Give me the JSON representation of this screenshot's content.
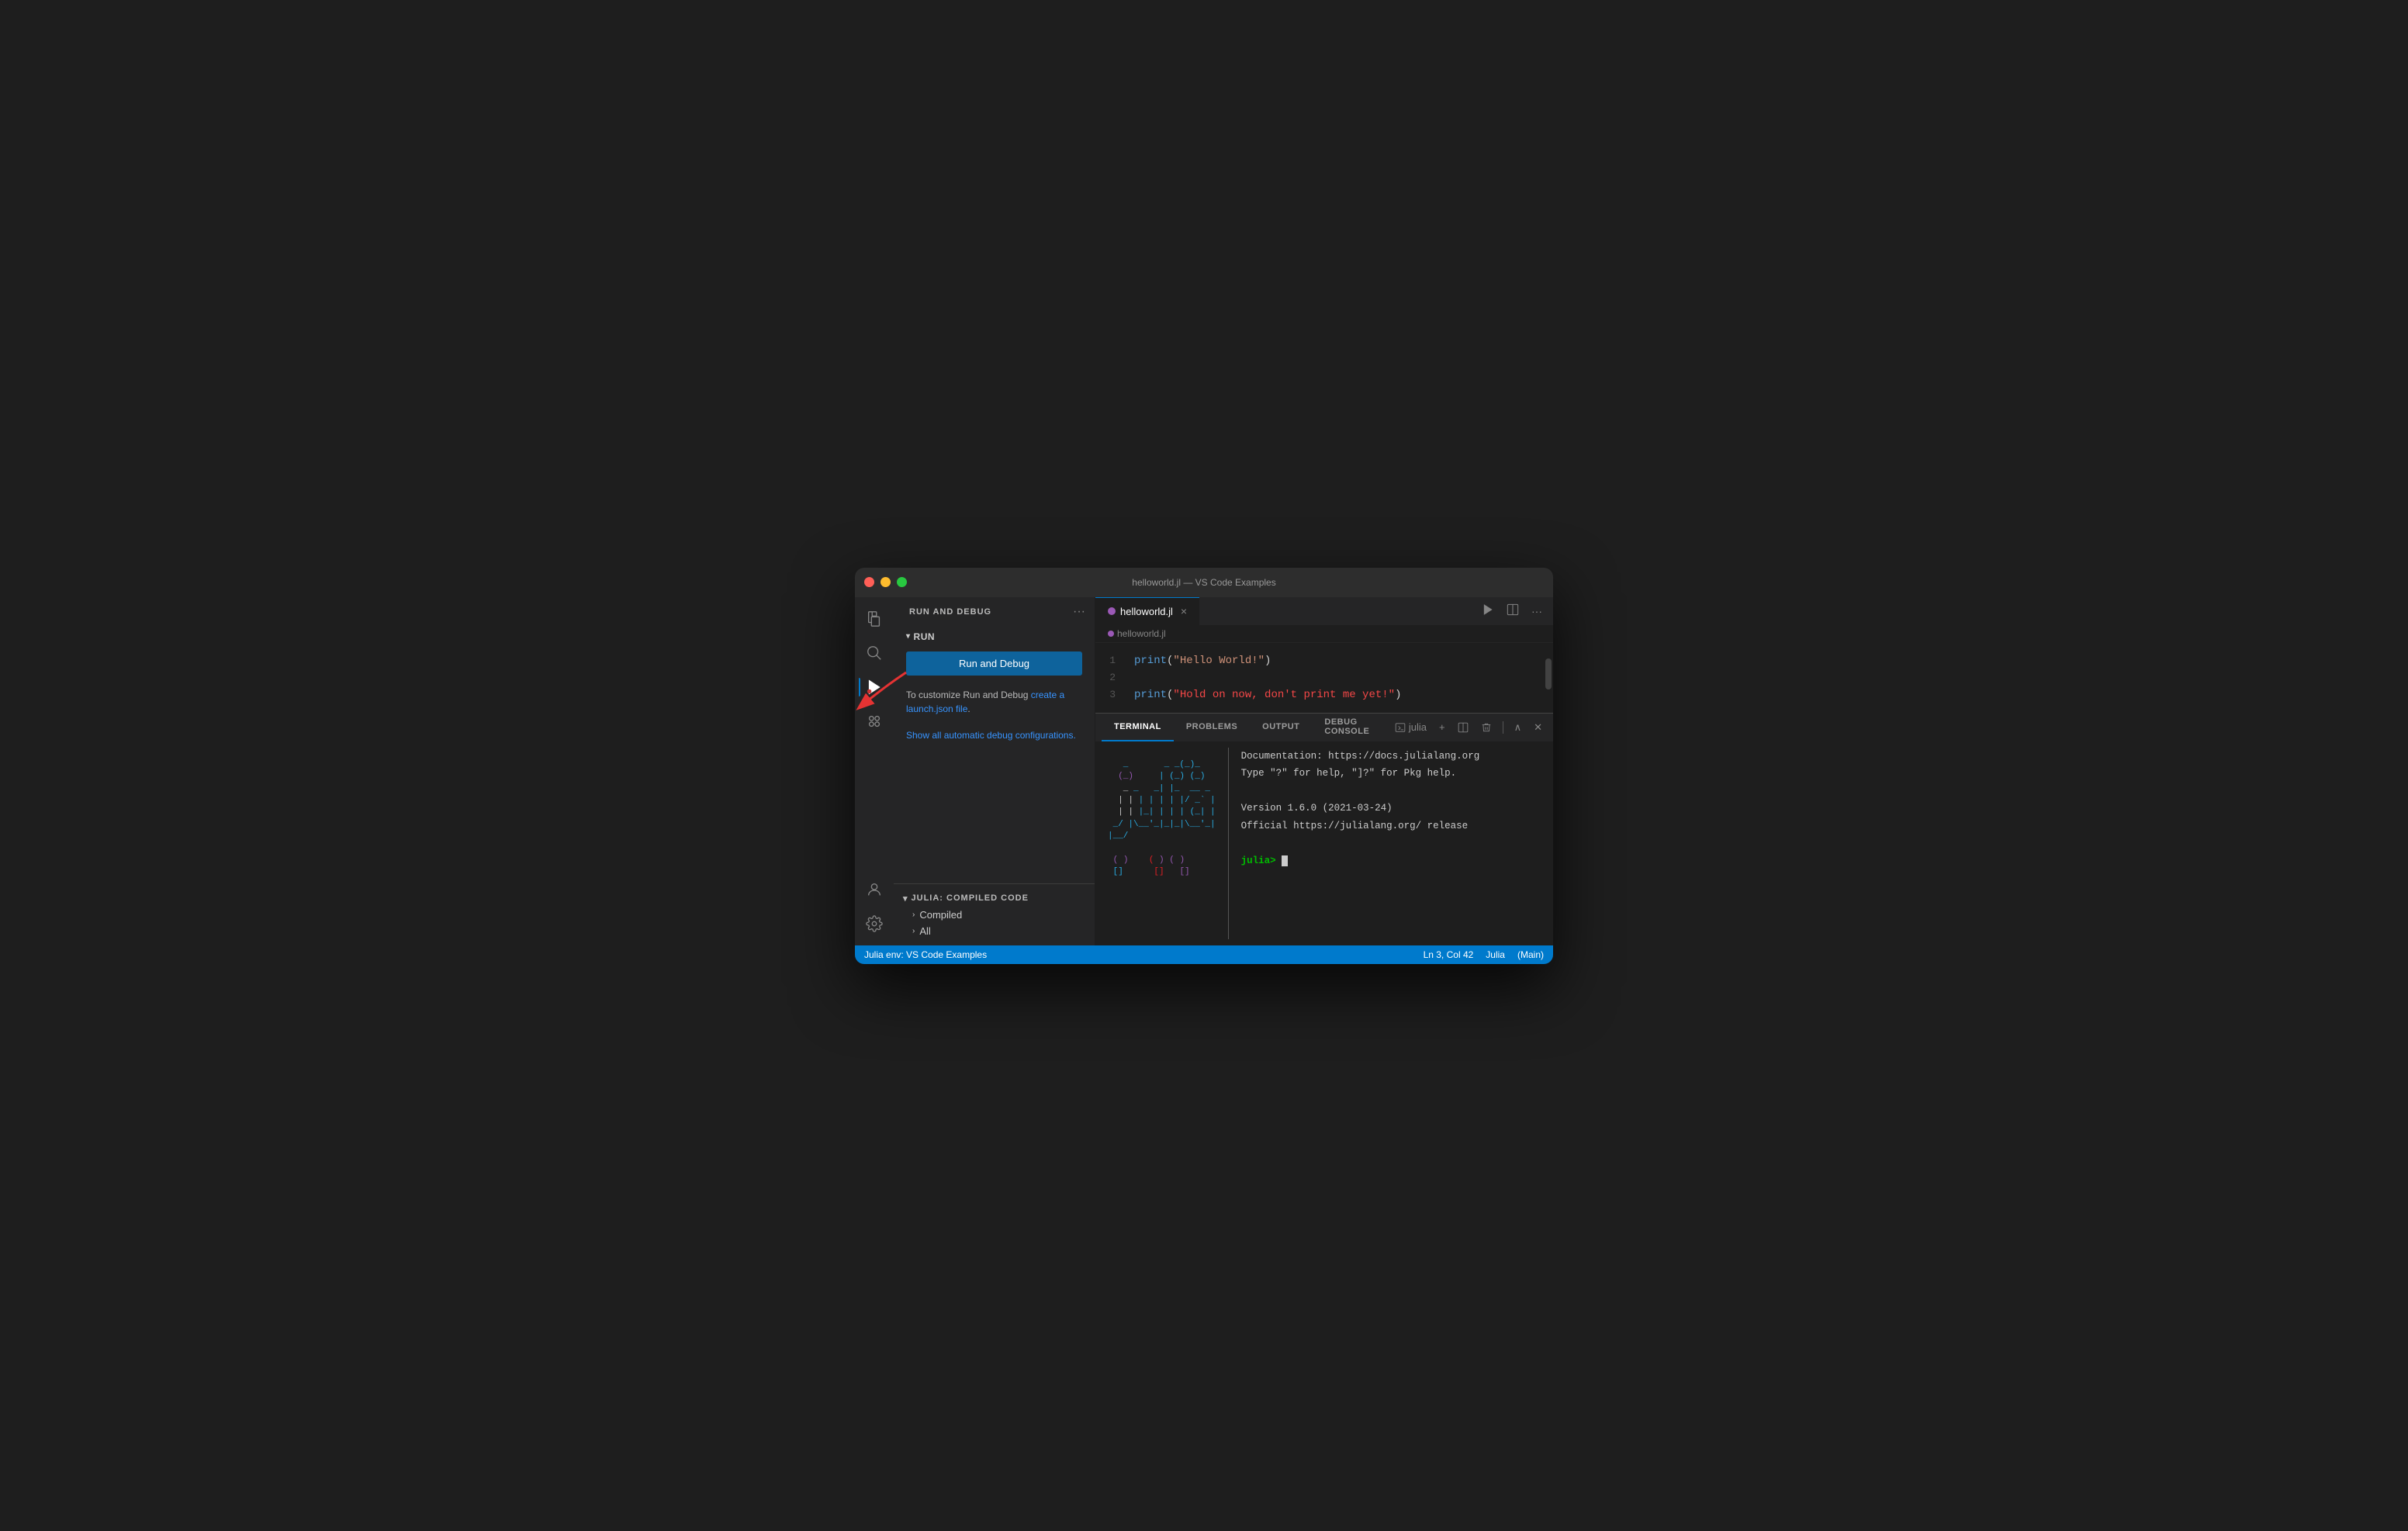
{
  "window": {
    "title": "helloworld.jl — VS Code Examples"
  },
  "titlebar": {
    "title": "helloworld.jl — VS Code Examples"
  },
  "activity_bar": {
    "icons": [
      {
        "name": "files-icon",
        "symbol": "⎘",
        "active": false
      },
      {
        "name": "search-icon",
        "symbol": "🔍",
        "active": false
      },
      {
        "name": "run-debug-icon",
        "symbol": "▶",
        "active": true
      },
      {
        "name": "extensions-icon",
        "symbol": "⊞",
        "active": false
      }
    ],
    "bottom_icons": [
      {
        "name": "account-icon",
        "symbol": "👤"
      },
      {
        "name": "settings-icon",
        "symbol": "⚙"
      }
    ]
  },
  "sidebar": {
    "header": "RUN AND DEBUG",
    "more_button": "···",
    "run_section": {
      "collapse_label": "RUN",
      "run_button": "Run and Debug",
      "description_text": "To customize Run and Debug ",
      "link_text": "create a launch.json file",
      "description_suffix": ".",
      "show_configs": "Show all automatic debug configurations."
    },
    "julia_section": {
      "header": "JULIA: COMPILED CODE",
      "items": [
        {
          "label": "Compiled"
        },
        {
          "label": "All"
        }
      ]
    }
  },
  "editor": {
    "tab_label": "helloworld.jl",
    "breadcrumb": "helloworld.jl",
    "lines": [
      {
        "number": "1",
        "content": "print(\"Hello World!\")"
      },
      {
        "number": "2",
        "content": ""
      },
      {
        "number": "3",
        "content": "print(\"Hold on now, don't print me yet!\")"
      }
    ]
  },
  "panel": {
    "tabs": [
      "TERMINAL",
      "PROBLEMS",
      "OUTPUT",
      "DEBUG CONSOLE"
    ],
    "active_tab": "TERMINAL",
    "terminal_label": "julia",
    "julia_art": "   _       _ _(_)_     |\n  (_)     | (_) (_)    |\n   _ _   _| |_  __ _  |\n  | | | | | | |/ _` | |\n  | | |_| | | | (_| | |\n _/ |\\__'_|_|_|\\__'_| |\n|__/                   |",
    "terminal_text": [
      "Documentation: https://docs.julialang.org",
      "Type \"?\" for help, \"]?\" for Pkg help.",
      "Version 1.6.0 (2021-03-24)",
      "Official https://julialang.org/ release"
    ],
    "prompt": "julia> "
  },
  "status_bar": {
    "left": "Julia env: VS Code Examples",
    "ln_col": "Ln 3, Col 42",
    "language": "Julia",
    "branch": "(Main)"
  }
}
